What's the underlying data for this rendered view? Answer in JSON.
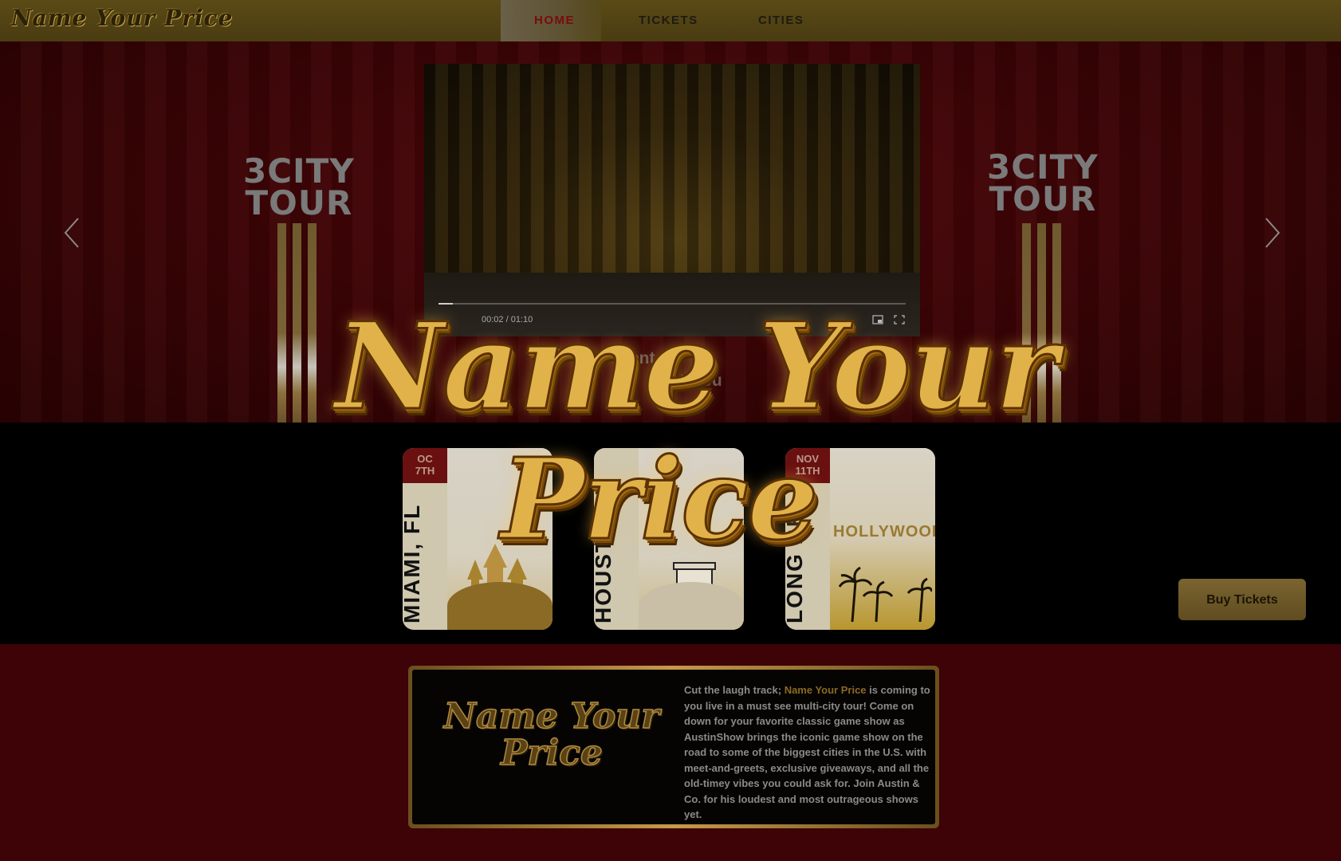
{
  "nav": {
    "brand": "Name Your Price",
    "links": [
      "HOME",
      "TICKETS",
      "CITIES"
    ]
  },
  "hero": {
    "tour_line1": "3CITY",
    "tour_line2": "TOUR",
    "video_time": "00:02 / 01:10",
    "video_progress": 0.03,
    "behind_text_1": "st",
    "behind_text_2": "ent c",
    "behind_text_3": "throu",
    "title_line1": "Name Your",
    "title_line2": "Price"
  },
  "tickets": [
    {
      "date_1": "OC",
      "date_2": "7TH",
      "city": "MIAMI, FL"
    },
    {
      "date_1": "",
      "date_2": "",
      "city": "HOUSTO"
    },
    {
      "date_1": "NOV",
      "date_2": "11TH",
      "city": "LONG BE",
      "sign": "HOLLYWOOD"
    }
  ],
  "buy_button": "Buy Tickets",
  "about": {
    "logo_line1": "Name Your",
    "logo_line2": "Price",
    "text_before": "Cut the laugh track; ",
    "text_highlight": "Name Your Price",
    "text_after": " is coming to you live in a must see multi-city tour! Come on down for your favorite classic game show as AustinShow brings the iconic game show on the road to some of the biggest cities in the U.S. with meet-and-greets, exclusive giveaways, and all the old-timey vibes you could ask for. Join Austin & Co. for his loudest and most outrageous shows yet."
  },
  "colors": {
    "nav_bg": "#4a3c12",
    "hero_bg": "#3d0306",
    "gold": "#e2b24a",
    "active_link": "#7a0c0c"
  },
  "icons": [
    "chevron-left-icon",
    "chevron-right-icon",
    "pip-icon",
    "fullscreen-icon"
  ]
}
